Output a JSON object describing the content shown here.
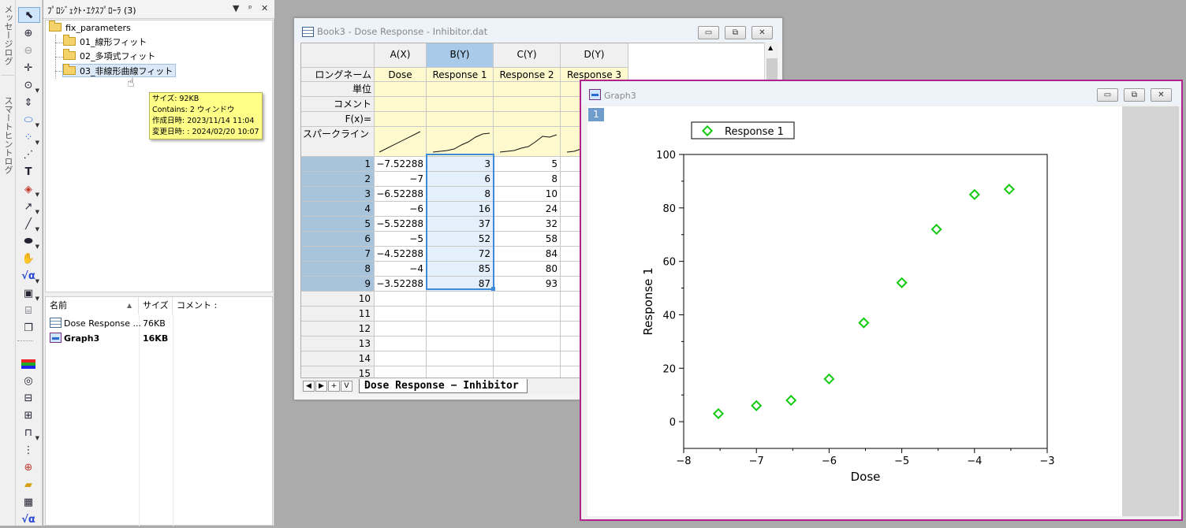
{
  "sidetabs": {
    "messages": "メッセージログ",
    "smart_hint": "スマートヒントログ"
  },
  "project_explorer": {
    "title": "ﾌﾟﾛｼﾞｪｸﾄ･ｴｸｽﾌﾟﾛｰﾗ (3)",
    "controls": {
      "dropdown": "▼",
      "pin": "ᵖ",
      "close": "✕"
    },
    "tree": {
      "root": "fix_parameters",
      "children": [
        "01_線形フィット",
        "02_多項式フィット",
        "03_非線形曲線フィット"
      ]
    },
    "tooltip": {
      "size": "サイズ: 92KB",
      "contains": "Contains: 2 ウィンドウ",
      "created": "作成日時: 2023/11/14 11:04",
      "modified": "変更日時: : 2024/02/20 10:07"
    },
    "list": {
      "headers": {
        "name": "名前",
        "size": "サイズ",
        "comment": "コメント :"
      },
      "rows": [
        {
          "name": "Dose Response ...",
          "size": "76KB",
          "icon": "workbook-icon"
        },
        {
          "name": "Graph3",
          "size": "16KB",
          "icon": "graph-icon"
        }
      ]
    }
  },
  "workbook": {
    "title": "Book3 - Dose Response - Inhibitor.dat",
    "buttons": {
      "minimize": "▭",
      "restore": "⧉",
      "close": "✕"
    },
    "columns": [
      "A(X)",
      "B(Y)",
      "C(Y)",
      "D(Y)"
    ],
    "row_labels": [
      "ロングネーム",
      "単位",
      "コメント",
      "F(x)=",
      "スパークライン"
    ],
    "long_names": [
      "Dose",
      "Response 1",
      "Response 2",
      "Response 3"
    ],
    "rows": [
      "1",
      "2",
      "3",
      "4",
      "5",
      "6",
      "7",
      "8",
      "9",
      "10",
      "11",
      "12",
      "13",
      "14",
      "15"
    ],
    "col_a": [
      "−7.52288",
      "−7",
      "−6.52288",
      "−6",
      "−5.52288",
      "−5",
      "−4.52288",
      "−4",
      "−3.52288"
    ],
    "col_b": [
      "3",
      "6",
      "8",
      "16",
      "37",
      "52",
      "72",
      "85",
      "87"
    ],
    "col_c": [
      "5",
      "8",
      "10",
      "24",
      "32",
      "58",
      "84",
      "80",
      "93"
    ],
    "sheet_tab": "Dose Response − Inhibitor",
    "nav": [
      "◀",
      "▶",
      "+",
      "V"
    ]
  },
  "graph": {
    "title": "Graph3",
    "layer": "1",
    "buttons": {
      "minimize": "▭",
      "restore": "⧉",
      "close": "✕"
    },
    "colors": {
      "series": "#11c911",
      "border": "#b0238f"
    },
    "chart_data": {
      "type": "scatter",
      "xlabel": "Dose",
      "ylabel": "Response 1",
      "xlim": [
        -8,
        -3
      ],
      "ylim": [
        -10,
        100
      ],
      "xticks": [
        "−8",
        "−7",
        "−6",
        "−5",
        "−4",
        "−3"
      ],
      "yticks": [
        "0",
        "20",
        "40",
        "60",
        "80",
        "100"
      ],
      "legend_position": "top-left",
      "series": [
        {
          "name": "Response 1",
          "x": [
            -7.52288,
            -7,
            -6.52288,
            -6,
            -5.52288,
            -5,
            -4.52288,
            -4,
            -3.52288
          ],
          "y": [
            3,
            6,
            8,
            16,
            37,
            52,
            72,
            85,
            87
          ]
        }
      ]
    }
  }
}
